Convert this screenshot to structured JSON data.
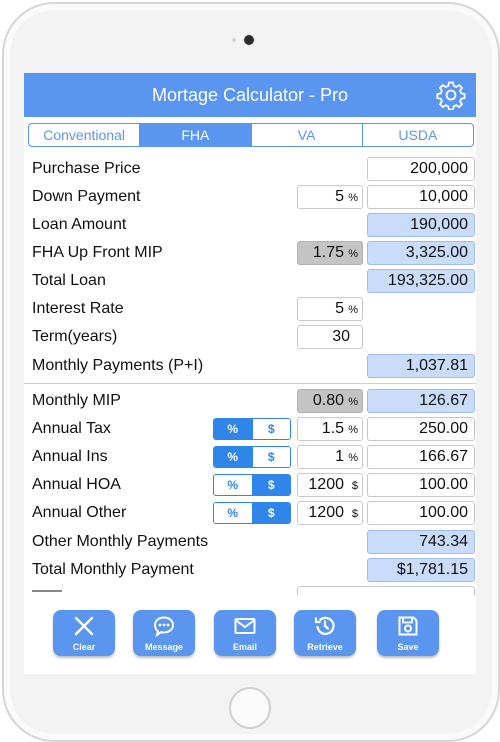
{
  "app": {
    "title": "Mortage Calculator - Pro",
    "settings_icon": "gear-icon",
    "accent_color": "#5a95f0"
  },
  "tabs": [
    {
      "label": "Conventional",
      "active": false
    },
    {
      "label": "FHA",
      "active": true
    },
    {
      "label": "VA",
      "active": false
    },
    {
      "label": "USDA",
      "active": false
    }
  ],
  "form": {
    "purchase_price": {
      "label": "Purchase Price",
      "value": "200,000"
    },
    "down_payment": {
      "label": "Down Payment",
      "percent": "5",
      "percent_unit": "%",
      "value": "10,000"
    },
    "loan_amount": {
      "label": "Loan Amount",
      "value": "190,000"
    },
    "fha_up_front_mip": {
      "label": "FHA Up Front MIP",
      "percent": "1.75",
      "percent_unit": "%",
      "value": "3,325.00"
    },
    "total_loan": {
      "label": "Total Loan",
      "value": "193,325.00"
    },
    "interest_rate": {
      "label": "Interest Rate",
      "percent": "5",
      "percent_unit": "%"
    },
    "term_years": {
      "label": "Term(years)",
      "value": "30"
    },
    "monthly_payments": {
      "label": "Monthly Payments (P+I)",
      "value": "1,037.81"
    },
    "monthly_mip": {
      "label": "Monthly MIP",
      "percent": "0.80",
      "percent_unit": "%",
      "value": "126.67"
    },
    "annual_tax": {
      "label": "Annual Tax",
      "mode": "%",
      "toggle": [
        "%",
        "$"
      ],
      "input": "1.5",
      "unit": "%",
      "value": "250.00"
    },
    "annual_ins": {
      "label": "Annual Ins",
      "mode": "%",
      "toggle": [
        "%",
        "$"
      ],
      "input": "1",
      "unit": "%",
      "value": "166.67"
    },
    "annual_hoa": {
      "label": "Annual HOA",
      "mode": "$",
      "toggle": [
        "%",
        "$"
      ],
      "input": "1200",
      "unit": "$",
      "value": "100.00"
    },
    "annual_other": {
      "label": "Annual Other",
      "mode": "$",
      "toggle": [
        "%",
        "$"
      ],
      "input": "1200",
      "unit": "$",
      "value": "100.00"
    },
    "other_monthly_payments": {
      "label": "Other Monthly Payments",
      "value": "743.34"
    },
    "total_monthly_payment": {
      "label": "Total Monthly Payment",
      "value": "$1,781.15"
    }
  },
  "toolbar": [
    {
      "label": "Clear",
      "icon": "x-icon"
    },
    {
      "label": "Message",
      "icon": "chat-bubble-icon"
    },
    {
      "label": "Email",
      "icon": "envelope-icon"
    },
    {
      "label": "Retrieve",
      "icon": "history-icon"
    },
    {
      "label": "Save",
      "icon": "floppy-disk-icon"
    }
  ]
}
